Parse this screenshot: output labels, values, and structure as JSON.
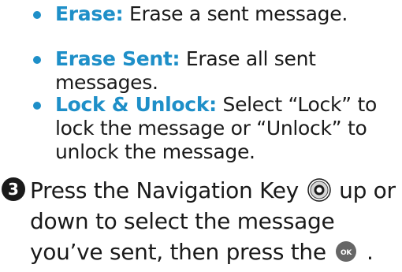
{
  "bullets": [
    {
      "term": "Erase:",
      "text": " Erase a sent message."
    },
    {
      "term": "Erase Sent:",
      "text": " Erase all sent messages."
    },
    {
      "term": "Lock & Unlock:",
      "text": " Select “Lock” to lock the message or “Unlock” to unlock the message."
    }
  ],
  "step": {
    "number": "3",
    "text_before_nav": "Press the Navigation Key ",
    "text_after_nav": " up or down to select the message you’ve sent, then press the ",
    "text_end": " .",
    "ok_key_label": "OK",
    "nav_key_icon": "navigation-key-icon",
    "ok_key_icon": "ok-key-icon"
  },
  "colors": {
    "accent": "#1e8fc8",
    "text": "#1a1a1a",
    "badge": "#1a1a1a"
  }
}
